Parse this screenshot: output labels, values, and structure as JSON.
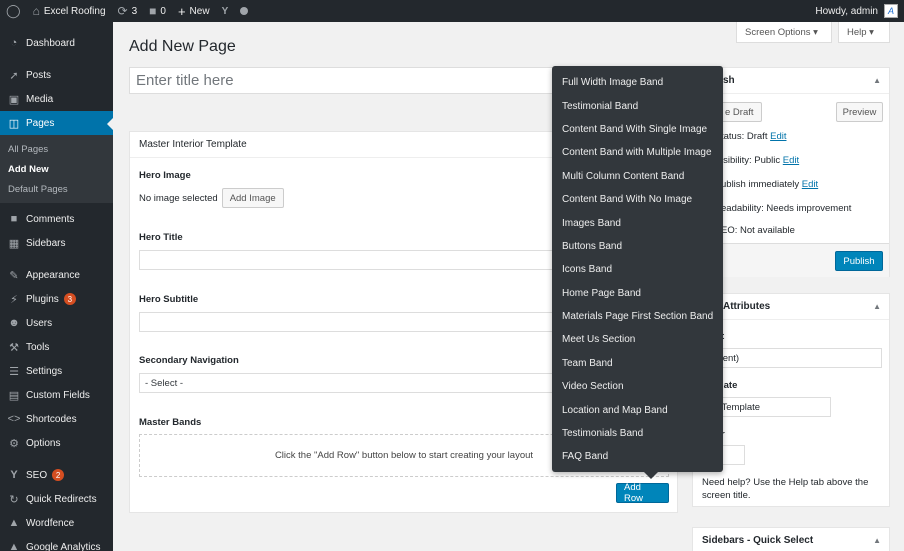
{
  "adminbar": {
    "site_name": "Excel Roofing",
    "updates_count": "3",
    "comments_count": "0",
    "new_label": "New",
    "howdy": "Howdy, admin",
    "avatar_letter": "A"
  },
  "sidebar": {
    "items": [
      {
        "label": "Dashboard",
        "icon": "dashboard-icon"
      },
      {
        "label": "Posts",
        "icon": "pin-icon"
      },
      {
        "label": "Media",
        "icon": "media-icon"
      },
      {
        "label": "Pages",
        "icon": "pages-icon"
      },
      {
        "label": "Comments",
        "icon": "comment-icon"
      },
      {
        "label": "Sidebars",
        "icon": "grid-icon"
      },
      {
        "label": "Appearance",
        "icon": "brush-icon"
      },
      {
        "label": "Plugins",
        "icon": "plug-icon",
        "badge": "3"
      },
      {
        "label": "Users",
        "icon": "user-icon"
      },
      {
        "label": "Tools",
        "icon": "wrench-icon"
      },
      {
        "label": "Settings",
        "icon": "settings-icon"
      },
      {
        "label": "Custom Fields",
        "icon": "fields-icon"
      },
      {
        "label": "Shortcodes",
        "icon": "code-icon"
      },
      {
        "label": "Options",
        "icon": "gear-icon"
      },
      {
        "label": "SEO",
        "icon": "yoast-icon",
        "badge": "2"
      },
      {
        "label": "Quick Redirects",
        "icon": "redirect-icon"
      },
      {
        "label": "Wordfence",
        "icon": "wordfence-icon"
      },
      {
        "label": "Google Analytics",
        "icon": "analytics-icon"
      }
    ],
    "pages_submenu": [
      "All Pages",
      "Add New",
      "Default Pages"
    ]
  },
  "header": {
    "title": "Add New Page",
    "screen_options": "Screen Options ▾",
    "help": "Help ▾"
  },
  "title_placeholder": "Enter title here",
  "master": {
    "title": "Master Interior Template",
    "hero_image_label": "Hero Image",
    "no_image": "No image selected",
    "add_image": "Add Image",
    "hero_title_label": "Hero Title",
    "hero_subtitle_label": "Hero Subtitle",
    "secondary_nav_label": "Secondary Navigation",
    "select_value": "- Select -",
    "master_bands_label": "Master Bands",
    "bands_hint": "Click the \"Add Row\" button below to start creating your layout",
    "add_row": "Add Row"
  },
  "publish": {
    "title": "sh",
    "save_draft": "e Draft",
    "preview": "Preview",
    "status": "tatus: Draft",
    "visibility": "isibility: Public",
    "publish_time": "ublish immediately",
    "readability": "eadability: Needs improvement",
    "seo": "EO: Not available",
    "edit": "Edit",
    "publish_btn": "Publish"
  },
  "attributes": {
    "title": "Attributes",
    "parent_label": "t",
    "parent_value": "parent)",
    "template_label": "late",
    "template_value": "ult Template",
    "order_label": "r",
    "help_text": "Need help? Use the Help tab above the screen title."
  },
  "sidebars_qs": {
    "title": "Sidebars - Quick Select"
  },
  "dropdown": {
    "items": [
      "Full Width Image Band",
      "Testimonial Band",
      "Content Band With Single Image",
      "Content Band with Multiple Image",
      "Multi Column Content Band",
      "Content Band With No Image",
      "Images Band",
      "Buttons Band",
      "Icons Band",
      "Home Page Band",
      "Materials Page First Section Band",
      "Meet Us Section",
      "Team Band",
      "Video Section",
      "Location and Map Band",
      "Testimonials Band",
      "FAQ Band"
    ]
  }
}
